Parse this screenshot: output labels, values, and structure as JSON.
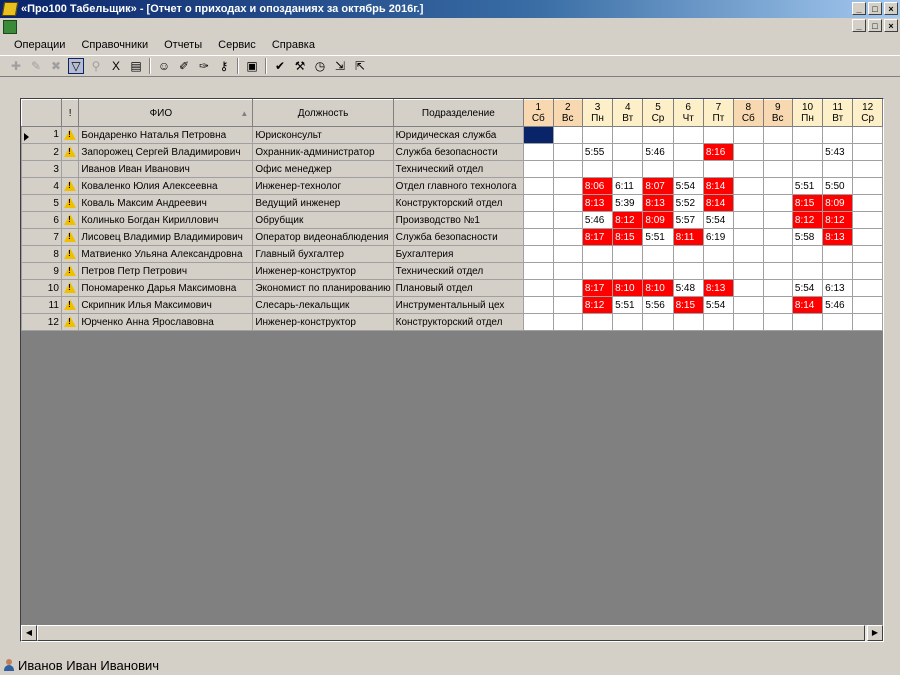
{
  "window": {
    "title": "«Про100 Табельщик» - [Отчет о приходах и опозданиях за октябрь 2016г.]",
    "min": "_",
    "max": "□",
    "close": "×"
  },
  "menu": [
    "Операции",
    "Справочники",
    "Отчеты",
    "Сервис",
    "Справка"
  ],
  "toolbar": [
    {
      "name": "add-icon",
      "glyph": "✚",
      "state": "disabled"
    },
    {
      "name": "edit-icon",
      "glyph": "✎",
      "state": "disabled"
    },
    {
      "name": "delete-icon",
      "glyph": "✖",
      "state": "disabled"
    },
    {
      "name": "filter-icon",
      "glyph": "▽",
      "state": "active"
    },
    {
      "name": "link-icon",
      "glyph": "⚲",
      "state": "disabled"
    },
    {
      "name": "excel-icon",
      "glyph": "X",
      "state": "normal"
    },
    {
      "name": "columns-icon",
      "glyph": "▤",
      "state": "normal"
    },
    {
      "sep": true
    },
    {
      "name": "users-icon",
      "glyph": "☺",
      "state": "normal"
    },
    {
      "name": "brush-icon",
      "glyph": "✐",
      "state": "normal"
    },
    {
      "name": "pin-icon",
      "glyph": "✑",
      "state": "normal"
    },
    {
      "name": "key-icon",
      "glyph": "⚷",
      "state": "normal"
    },
    {
      "sep": true
    },
    {
      "name": "report-icon",
      "glyph": "▣",
      "state": "normal"
    },
    {
      "sep": true
    },
    {
      "name": "check-list-icon",
      "glyph": "✔",
      "state": "normal"
    },
    {
      "name": "tools-icon",
      "glyph": "⚒",
      "state": "normal"
    },
    {
      "name": "clock-icon",
      "glyph": "◷",
      "state": "normal"
    },
    {
      "name": "import-icon",
      "glyph": "⇲",
      "state": "normal"
    },
    {
      "name": "export-icon",
      "glyph": "⇱",
      "state": "normal"
    }
  ],
  "grid": {
    "headers": {
      "warn": "!",
      "fio": "ФИО",
      "position": "Должность",
      "department": "Подразделение"
    },
    "days": [
      {
        "n": "1",
        "d": "Сб",
        "weekend": true
      },
      {
        "n": "2",
        "d": "Вс",
        "weekend": true
      },
      {
        "n": "3",
        "d": "Пн",
        "weekend": false
      },
      {
        "n": "4",
        "d": "Вт",
        "weekend": false
      },
      {
        "n": "5",
        "d": "Ср",
        "weekend": false
      },
      {
        "n": "6",
        "d": "Чт",
        "weekend": false
      },
      {
        "n": "7",
        "d": "Пт",
        "weekend": false
      },
      {
        "n": "8",
        "d": "Сб",
        "weekend": true
      },
      {
        "n": "9",
        "d": "Вс",
        "weekend": true
      },
      {
        "n": "10",
        "d": "Пн",
        "weekend": false
      },
      {
        "n": "11",
        "d": "Вт",
        "weekend": false
      },
      {
        "n": "12",
        "d": "Ср",
        "weekend": false
      }
    ],
    "rows": [
      {
        "num": "1",
        "warn": true,
        "fio": "Бондаренко Наталья Петровна",
        "position": "Юрисконсульт",
        "department": "Юридическая служба",
        "current": true,
        "times": [
          "",
          "",
          "",
          "",
          "",
          "",
          "",
          "",
          "",
          "",
          "",
          ""
        ],
        "late": []
      },
      {
        "num": "2",
        "warn": true,
        "fio": "Запорожец Сергей Владимирович",
        "position": "Охранник-администратор",
        "department": "Служба безопасности",
        "times": [
          "",
          "",
          "5:55",
          "",
          "5:46",
          "",
          "8:16",
          "",
          "",
          "",
          "5:43",
          ""
        ],
        "late": [
          6
        ]
      },
      {
        "num": "3",
        "warn": false,
        "fio": "Иванов Иван Иванович",
        "position": "Офис менеджер",
        "department": "Технический отдел",
        "times": [
          "",
          "",
          "",
          "",
          "",
          "",
          "",
          "",
          "",
          "",
          "",
          ""
        ],
        "late": []
      },
      {
        "num": "4",
        "warn": true,
        "fio": "Коваленко Юлия Алексеевна",
        "position": "Инженер-технолог",
        "department": "Отдел главного технолога",
        "times": [
          "",
          "",
          "8:06",
          "6:11",
          "8:07",
          "5:54",
          "8:14",
          "",
          "",
          "5:51",
          "5:50",
          ""
        ],
        "late": [
          2,
          4,
          6
        ]
      },
      {
        "num": "5",
        "warn": true,
        "fio": "Коваль Максим Андреевич",
        "position": "Ведущий инженер",
        "department": "Конструкторский отдел",
        "times": [
          "",
          "",
          "8:13",
          "5:39",
          "8:13",
          "5:52",
          "8:14",
          "",
          "",
          "8:15",
          "8:09",
          ""
        ],
        "late": [
          2,
          4,
          6,
          9,
          10
        ]
      },
      {
        "num": "6",
        "warn": true,
        "fio": "Колинько Богдан Кириллович",
        "position": "Обрубщик",
        "department": "Производство №1",
        "times": [
          "",
          "",
          "5:46",
          "8:12",
          "8:09",
          "5:57",
          "5:54",
          "",
          "",
          "8:12",
          "8:12",
          ""
        ],
        "late": [
          3,
          4,
          9,
          10
        ]
      },
      {
        "num": "7",
        "warn": true,
        "fio": "Лисовец Владимир Владимирович",
        "position": "Оператор видеонаблюдения",
        "department": "Служба безопасности",
        "times": [
          "",
          "",
          "8:17",
          "8:15",
          "5:51",
          "8:11",
          "6:19",
          "",
          "",
          "5:58",
          "8:13",
          ""
        ],
        "late": [
          2,
          3,
          5,
          10
        ]
      },
      {
        "num": "8",
        "warn": true,
        "fio": "Матвиенко Ульяна Александровна",
        "position": "Главный бухгалтер",
        "department": "Бухгалтерия",
        "times": [
          "",
          "",
          "",
          "",
          "",
          "",
          "",
          "",
          "",
          "",
          "",
          ""
        ],
        "late": []
      },
      {
        "num": "9",
        "warn": true,
        "fio": "Петров Петр Петрович",
        "position": "Инженер-конструктор",
        "department": "Технический отдел",
        "times": [
          "",
          "",
          "",
          "",
          "",
          "",
          "",
          "",
          "",
          "",
          "",
          ""
        ],
        "late": []
      },
      {
        "num": "10",
        "warn": true,
        "fio": "Пономаренко Дарья Максимовна",
        "position": "Экономист по планированию",
        "department": "Плановый отдел",
        "times": [
          "",
          "",
          "8:17",
          "8:10",
          "8:10",
          "5:48",
          "8:13",
          "",
          "",
          "5:54",
          "6:13",
          ""
        ],
        "late": [
          2,
          3,
          4,
          6
        ]
      },
      {
        "num": "11",
        "warn": true,
        "fio": "Скрипник Илья Максимович",
        "position": "Слесарь-лекальщик",
        "department": "Инструментальный цех",
        "times": [
          "",
          "",
          "8:12",
          "5:51",
          "5:56",
          "8:15",
          "5:54",
          "",
          "",
          "8:14",
          "5:46",
          ""
        ],
        "late": [
          2,
          5,
          9
        ]
      },
      {
        "num": "12",
        "warn": true,
        "fio": "Юрченко Анна Ярославовна",
        "position": "Инженер-конструктор",
        "department": "Конструкторский отдел",
        "times": [
          "",
          "",
          "",
          "",
          "",
          "",
          "",
          "",
          "",
          "",
          "",
          ""
        ],
        "late": []
      }
    ]
  },
  "status": {
    "user": "Иванов Иван Иванович"
  },
  "colors": {
    "late": "#ff0000",
    "selected": "#0a246a",
    "weekend_header": "#f8d8b0"
  }
}
